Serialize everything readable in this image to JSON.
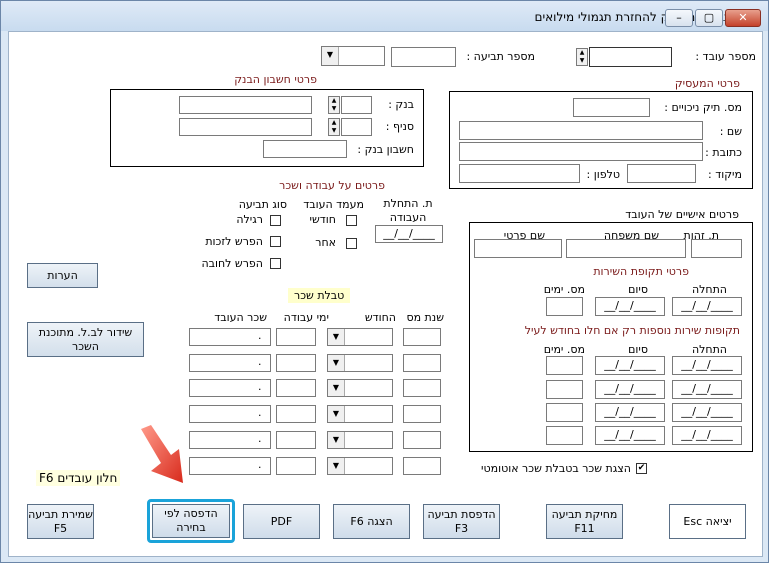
{
  "window": {
    "title": "תביעת מעסיק להחזרת תגמולי מילואים",
    "minimize": "–",
    "maximize": "▢",
    "close": "✕"
  },
  "top": {
    "employee_no_label": "מספר עובד :",
    "claim_no_label": "מספר תביעה :"
  },
  "employer": {
    "header": "פרטי המעסיק",
    "file_no_label": "מס. תיק ניכויים :",
    "name_label": "שם :",
    "address_label": "כתובת :",
    "zip_label": "מיקוד :",
    "phone_label": "טלפון :"
  },
  "bank": {
    "header": "פרטי חשבון הבנק",
    "bank_label": "בנק :",
    "branch_label": "סניף :",
    "account_label": "חשבון בנק :"
  },
  "work": {
    "header": "פרטים על עבודה ושכר",
    "start_date_label": "ת. התחלת העבודה",
    "start_date_value": "__/__/____",
    "status_label": "מעמד העובד",
    "monthly_label": "חודשי",
    "other_label": "אחר",
    "claim_type_label": "סוג תביעה",
    "regular_label": "רגילה",
    "entitlement_diff_label": "הפרש לזכות",
    "debit_diff_label": "הפרש לחובה"
  },
  "personal": {
    "header": "פרטים אישיים של העובד",
    "id_label": "ת. זהות",
    "last_name_label": "שם משפחה",
    "first_name_label": "שם פרטי",
    "service_header": "פרטי תקופת השירות",
    "start_label": "התחלה",
    "end_label": "סיום",
    "days_label": "מס. ימים",
    "date_value": "__/__/____",
    "extra_header": "תקופות שירות נוספות רק אם חלו בחודש לעיל",
    "auto_salary_label": "הצגת שכר בטבלת שכר אוטומטי",
    "auto_salary_checked": "✔"
  },
  "salary": {
    "header": "טבלת שכר",
    "tax_year_label": "שנת מס",
    "month_label": "החודש",
    "work_days_label": "ימי עבודה",
    "employee_salary_label": "שכר העובד",
    "dot": "."
  },
  "buttons": {
    "notes": "הערות",
    "send_software": "שידור לב.ל. מתוכנת\nהשכר",
    "employees_window": "חלון עובדים F6",
    "save_claim": "שמירת תביעה\nF5",
    "print_selection": "הדפסה לפי\nבחירה",
    "pdf": "PDF",
    "display": "הצגה F6",
    "print_claim": "הדפסת תביעה\nF3",
    "delete_claim": "מחיקת תביעה\nF11",
    "exit": "יציאה Esc"
  },
  "colors": {
    "header_red": "#7a1a1a",
    "highlight": "#1aa3d9",
    "arrow": "#e03a2c",
    "salary_header_bg": "#ffffcc"
  }
}
